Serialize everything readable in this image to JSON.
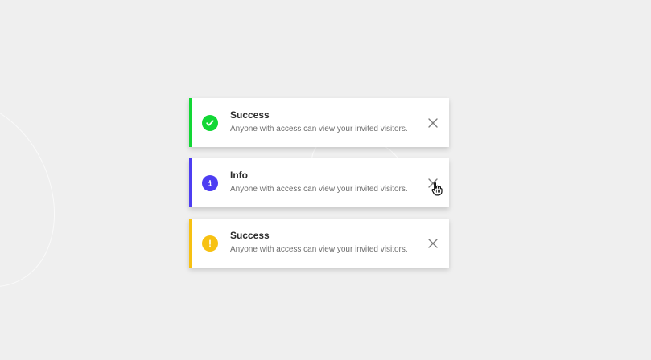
{
  "notifications": [
    {
      "type": "success",
      "title": "Success",
      "message": "Anyone with access can view your invited visitors.",
      "icon": "check-circle-icon",
      "color": "#12d735"
    },
    {
      "type": "info",
      "title": "Info",
      "message": "Anyone with access can view your invited visitors.",
      "icon": "info-circle-icon",
      "color": "#4d3df2"
    },
    {
      "type": "warning",
      "title": "Success",
      "message": "Anyone with access can view your invited visitors.",
      "icon": "warning-circle-icon",
      "color": "#f7c112"
    }
  ],
  "colors": {
    "background": "#efefef",
    "card": "#ffffff",
    "title": "#2d2d2d",
    "message": "#6f6f6f",
    "close": "#7d7d7d"
  },
  "cursor": {
    "icon": "hand-pointer-icon"
  }
}
